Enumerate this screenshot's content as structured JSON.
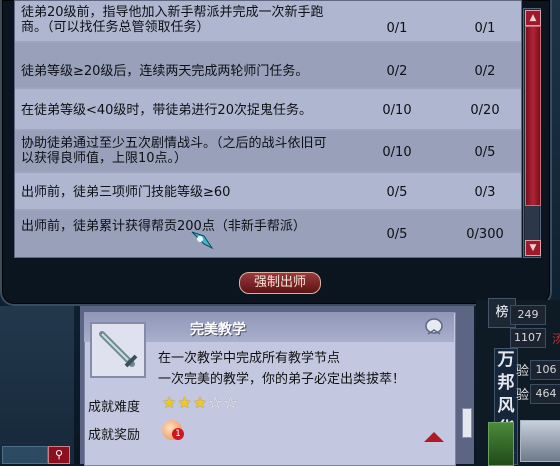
{
  "tasks": [
    {
      "desc": "徒弟20级前，指导他加入新手帮派并完成一次新手跑商。（可以找任务总管领取任务）",
      "c1": "0/1",
      "c2": "0/1"
    },
    {
      "desc": "徒弟等级≥20级后，连续两天完成两轮师门任务。",
      "c1": "0/2",
      "c2": "0/2"
    },
    {
      "desc": "在徒弟等级<40级时，带徒弟进行20次捉鬼任务。",
      "c1": "0/10",
      "c2": "0/20"
    },
    {
      "desc": "协助徒弟通过至少五次剧情战斗。（之后的战斗依旧可以获得良师值，上限10点。）",
      "c1": "0/10",
      "c2": "0/5"
    },
    {
      "desc": "出师前，徒弟三项师门技能等级≥60",
      "c1": "0/5",
      "c2": "0/3"
    },
    {
      "desc": "出师前，徒弟累计获得帮贡200点（非新手帮派）",
      "c1": "0/5",
      "c2": "0/300"
    }
  ],
  "force_button": "强制出师",
  "achievement": {
    "title": "完美教学",
    "desc1": "在一次教学中完成所有教学节点",
    "desc2": "一次完美的教学，你的弟子必定出类拔萃！",
    "difficulty_label": "成就难度",
    "difficulty_stars": 3,
    "difficulty_max": 5,
    "stars_on": "★★★",
    "stars_off": "☆☆",
    "reward_label": "成就奖励",
    "reward_badge": "1"
  },
  "right_panel": {
    "rank_label": "榜",
    "banner": "万邦风华赛",
    "stats": [
      {
        "label": "",
        "value": "249"
      },
      {
        "label": "",
        "value": "1107"
      },
      {
        "label": "验",
        "value": "106"
      },
      {
        "label": "验",
        "value": "464"
      }
    ],
    "red_char": "汤"
  },
  "icons": {
    "scroll_up": "up-arrow-icon",
    "scroll_down": "down-arrow-icon",
    "search": "search-icon",
    "share": "share-icon",
    "collapse": "collapse-up-icon",
    "sword": "sword-icon",
    "reward": "reward-icon"
  },
  "colors": {
    "accent_red": "#9e1a2a",
    "row_light": "#afb6cf",
    "row_dark": "#98a0ba",
    "star": "#f0c820"
  }
}
